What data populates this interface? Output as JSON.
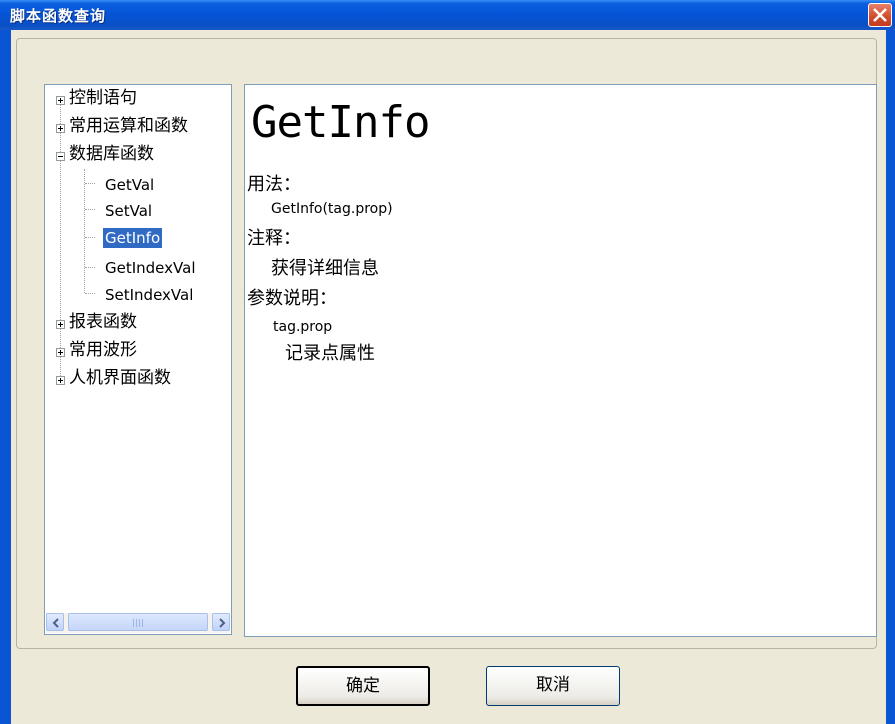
{
  "window": {
    "title": "脚本函数查询"
  },
  "tree": {
    "nodes": [
      {
        "label": "控制语句",
        "expanded": false
      },
      {
        "label": "常用运算和函数",
        "expanded": false
      },
      {
        "label": "数据库函数",
        "expanded": true
      },
      {
        "label": "报表函数",
        "expanded": false
      },
      {
        "label": "常用波形",
        "expanded": false
      },
      {
        "label": "人机界面函数",
        "expanded": false
      }
    ],
    "db_children": [
      "GetVal",
      "SetVal",
      "GetInfo",
      "GetIndexVal",
      "SetIndexVal"
    ],
    "selected": "GetInfo"
  },
  "content": {
    "title": "GetInfo",
    "usage_label": "用法：",
    "usage": "GetInfo(tag.prop)",
    "note_label": "注释：",
    "note": "获得详细信息",
    "params_label": "参数说明：",
    "param_name": "tag.prop",
    "param_desc": "记录点属性"
  },
  "buttons": {
    "ok": "确定",
    "cancel": "取消"
  },
  "colors": {
    "titlebar": "#0654d6",
    "selection": "#316ac5",
    "dialog_bg": "#ece9d8"
  }
}
